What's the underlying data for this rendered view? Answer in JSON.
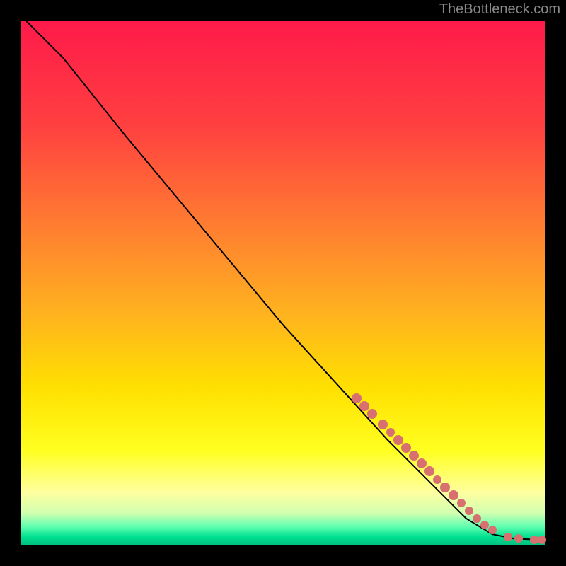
{
  "attribution": "TheBottleneck.com",
  "chart_data": {
    "type": "line",
    "title": "",
    "xlabel": "",
    "ylabel": "",
    "xlim": [
      0,
      100
    ],
    "ylim": [
      0,
      100
    ],
    "gradient_stops": [
      {
        "offset": 0,
        "color": "#ff1a4a"
      },
      {
        "offset": 0.2,
        "color": "#ff4040"
      },
      {
        "offset": 0.4,
        "color": "#ff8030"
      },
      {
        "offset": 0.55,
        "color": "#ffb020"
      },
      {
        "offset": 0.7,
        "color": "#ffe000"
      },
      {
        "offset": 0.82,
        "color": "#ffff20"
      },
      {
        "offset": 0.9,
        "color": "#ffffa0"
      },
      {
        "offset": 0.94,
        "color": "#d0ffb0"
      },
      {
        "offset": 0.965,
        "color": "#60ffb0"
      },
      {
        "offset": 0.985,
        "color": "#00e090"
      },
      {
        "offset": 1.0,
        "color": "#00c080"
      }
    ],
    "curve": [
      {
        "x": 1,
        "y": 100
      },
      {
        "x": 4,
        "y": 97
      },
      {
        "x": 8,
        "y": 93
      },
      {
        "x": 12,
        "y": 88
      },
      {
        "x": 20,
        "y": 78
      },
      {
        "x": 30,
        "y": 66
      },
      {
        "x": 40,
        "y": 54
      },
      {
        "x": 50,
        "y": 42
      },
      {
        "x": 60,
        "y": 31
      },
      {
        "x": 70,
        "y": 20
      },
      {
        "x": 78,
        "y": 12
      },
      {
        "x": 85,
        "y": 5
      },
      {
        "x": 90,
        "y": 2
      },
      {
        "x": 94,
        "y": 1.2
      },
      {
        "x": 98,
        "y": 1
      },
      {
        "x": 100,
        "y": 1
      }
    ],
    "points": [
      {
        "x": 64,
        "y": 28,
        "r": 7
      },
      {
        "x": 65.5,
        "y": 26.5,
        "r": 7
      },
      {
        "x": 67,
        "y": 25,
        "r": 7
      },
      {
        "x": 69,
        "y": 23,
        "r": 7
      },
      {
        "x": 70.5,
        "y": 21.5,
        "r": 6
      },
      {
        "x": 72,
        "y": 20,
        "r": 7
      },
      {
        "x": 73.5,
        "y": 18.5,
        "r": 7
      },
      {
        "x": 75,
        "y": 17,
        "r": 7
      },
      {
        "x": 76.5,
        "y": 15.5,
        "r": 7
      },
      {
        "x": 78,
        "y": 14,
        "r": 7
      },
      {
        "x": 79.5,
        "y": 12.5,
        "r": 6
      },
      {
        "x": 81,
        "y": 11,
        "r": 7
      },
      {
        "x": 82.5,
        "y": 9.5,
        "r": 7
      },
      {
        "x": 84,
        "y": 8,
        "r": 6
      },
      {
        "x": 85.5,
        "y": 6.5,
        "r": 6
      },
      {
        "x": 87,
        "y": 5,
        "r": 6
      },
      {
        "x": 88.5,
        "y": 3.8,
        "r": 6
      },
      {
        "x": 90,
        "y": 2.8,
        "r": 6
      },
      {
        "x": 93,
        "y": 1.5,
        "r": 6
      },
      {
        "x": 95,
        "y": 1.2,
        "r": 6
      },
      {
        "x": 98,
        "y": 1,
        "r": 6
      },
      {
        "x": 99.5,
        "y": 1,
        "r": 6
      }
    ]
  }
}
